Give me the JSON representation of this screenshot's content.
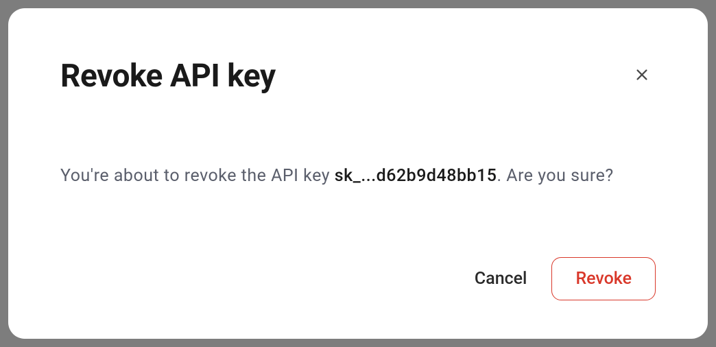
{
  "modal": {
    "title": "Revoke API key",
    "body_prefix": "You're about to revoke the API key ",
    "api_key": "sk_...d62b9d48bb15",
    "body_suffix": ". Are you sure?",
    "cancel_label": "Cancel",
    "revoke_label": "Revoke"
  }
}
